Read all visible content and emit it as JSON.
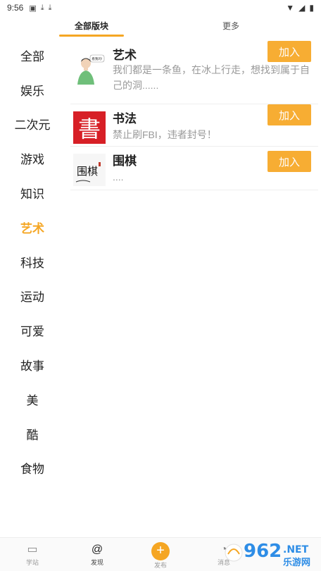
{
  "status_bar": {
    "time": "9:56",
    "icons": [
      "image-notification-icon",
      "download-icon",
      "download-icon",
      "wifi-icon",
      "signal-icon",
      "battery-icon"
    ]
  },
  "tabs": [
    {
      "label": "全部版块",
      "active": true
    },
    {
      "label": "更多",
      "active": false
    }
  ],
  "categories": [
    {
      "label": "全部",
      "active": false
    },
    {
      "label": "娱乐",
      "active": false
    },
    {
      "label": "二次元",
      "active": false
    },
    {
      "label": "游戏",
      "active": false
    },
    {
      "label": "知识",
      "active": false
    },
    {
      "label": "艺术",
      "active": true
    },
    {
      "label": "科技",
      "active": false
    },
    {
      "label": "运动",
      "active": false
    },
    {
      "label": "可爱",
      "active": false
    },
    {
      "label": "故事",
      "active": false
    },
    {
      "label": "美",
      "active": false
    },
    {
      "label": "酷",
      "active": false
    },
    {
      "label": "食物",
      "active": false
    }
  ],
  "boards": [
    {
      "title": "艺术",
      "description": "我们都是一条鱼，在冰上行走，想找到属于自己的洞......",
      "join_label": "加入",
      "thumb_text": "看我的!"
    },
    {
      "title": "书法",
      "description": "禁止刷FBI，违者封号！",
      "join_label": "加入",
      "thumb_text": "書"
    },
    {
      "title": "围棋",
      "description": "....",
      "join_label": "加入",
      "thumb_text": "围棋"
    }
  ],
  "bottom_nav": [
    {
      "label": "学站",
      "icon": "square-icon",
      "active": false
    },
    {
      "label": "发现",
      "icon": "at-icon",
      "active": true
    },
    {
      "label": "发布",
      "icon": "plus-icon",
      "active": false
    },
    {
      "label": "消息",
      "icon": "message-icon",
      "active": false
    }
  ],
  "watermark": {
    "brand": "962",
    "suffix": ".NET",
    "caption": "乐游网"
  },
  "colors": {
    "accent": "#f5a623",
    "join_button": "#f7ad33",
    "calligraphy_red": "#d71f26"
  }
}
